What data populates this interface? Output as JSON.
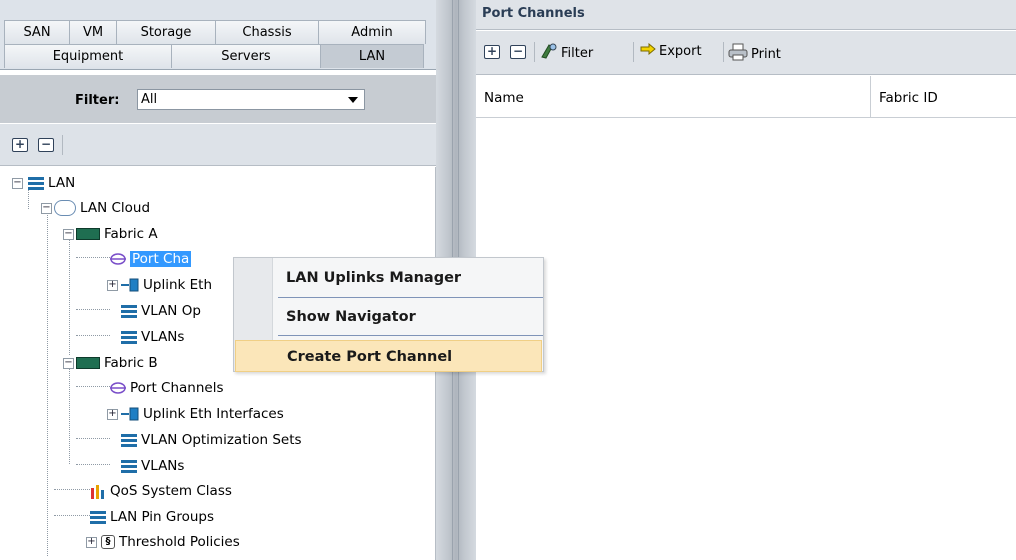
{
  "left_pane": {
    "tabs_row1": [
      "SAN",
      "VM",
      "Storage",
      "Chassis",
      "Admin"
    ],
    "tabs_row2": [
      "Equipment",
      "Servers",
      "LAN"
    ],
    "active_tab": "LAN",
    "filter": {
      "label": "Filter:",
      "value": "All"
    },
    "tree_toolbar": {
      "expand_label": "+",
      "collapse_label": "−"
    },
    "tree": [
      {
        "label": "LAN"
      },
      {
        "label": "LAN Cloud"
      },
      {
        "label": "Fabric A"
      },
      {
        "label": "Port Channels",
        "shown": "Port Cha"
      },
      {
        "label": "Uplink Eth Interfaces",
        "shown": "Uplink Eth"
      },
      {
        "label": "VLAN Optimization Sets",
        "shown": "VLAN Op"
      },
      {
        "label": "VLANs"
      },
      {
        "label": "Fabric B"
      },
      {
        "label": "Port Channels"
      },
      {
        "label": "Uplink Eth Interfaces"
      },
      {
        "label": "VLAN Optimization Sets"
      },
      {
        "label": "VLANs"
      },
      {
        "label": "QoS System Class"
      },
      {
        "label": "LAN Pin Groups"
      },
      {
        "label": "Threshold Policies"
      }
    ]
  },
  "right_pane": {
    "title": "Port Channels",
    "toolbar": {
      "add": "+",
      "remove": "−",
      "filter": "Filter",
      "export": "Export",
      "print": "Print"
    },
    "columns": [
      "Name",
      "Fabric ID"
    ]
  },
  "context_menu": {
    "items": [
      "LAN Uplinks Manager",
      "Show Navigator",
      "Create Port Channel"
    ],
    "highlighted_index": 2
  },
  "colors": {
    "selection": "#3399ff",
    "menu_highlight": "#fbe6b9",
    "tree_icon_blue": "#1f6ea8",
    "fabric_green": "#1f6e51"
  }
}
